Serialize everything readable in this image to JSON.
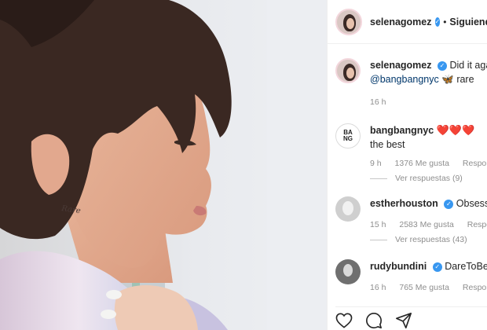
{
  "post": {
    "photo_label": "Rare"
  },
  "header": {
    "username": "selenagomez",
    "separator": "•",
    "follow_status": "Siguiendo"
  },
  "caption": {
    "username": "selenagomez",
    "text": "Did it again",
    "mention": "@bangbangnyc",
    "emoji": "🦋",
    "tail": "rare",
    "time": "16 h"
  },
  "comments": [
    {
      "username": "bangbangnyc",
      "avatar_text": "BA\nNG",
      "text_line1": "❤️❤️❤️",
      "text_line2": "the best",
      "time": "9 h",
      "likes": "1376 Me gusta",
      "reply_label": "Responder",
      "view_replies": "Ver respuestas (9)"
    },
    {
      "username": "estherhouston",
      "text_line1": "Obsessed",
      "time": "15 h",
      "likes": "2583 Me gusta",
      "reply_label": "Responder",
      "view_replies": "Ver respuestas (43)"
    },
    {
      "username": "rudybundini",
      "text_line1": "DareToBeRare",
      "time": "16 h",
      "likes": "765 Me gusta",
      "reply_label": "Responder"
    }
  ],
  "icons": {
    "verified": "verified-badge-icon",
    "like": "heart-icon",
    "comment": "comment-icon",
    "share": "share-icon"
  },
  "colors": {
    "text": "#262626",
    "muted": "#8e8e8e",
    "mention": "#00376b",
    "verified": "#3897f0",
    "heart": "#ed4956"
  }
}
